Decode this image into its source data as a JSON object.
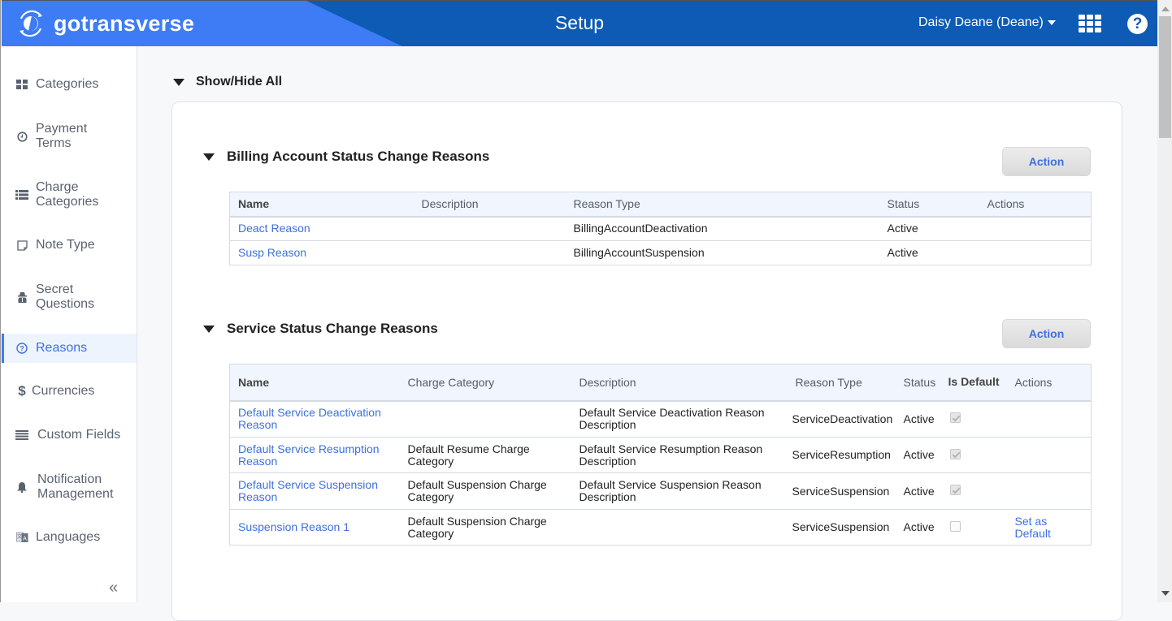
{
  "header": {
    "brand": "gotransverse",
    "title": "Setup",
    "user": "Daisy Deane (Deane)",
    "colors": {
      "banner": "#0d5bb5",
      "brand_bg": "#3d7cf5"
    }
  },
  "sidebar": {
    "items": [
      {
        "label": "Categories",
        "icon": "grid-icon"
      },
      {
        "label": "Payment Terms",
        "icon": "clock-icon"
      },
      {
        "label": "Charge Categories",
        "icon": "list-icon"
      },
      {
        "label": "Note Type",
        "icon": "note-icon"
      },
      {
        "label": "Secret Questions",
        "icon": "spy-icon"
      },
      {
        "label": "Reasons",
        "icon": "question-circle-icon",
        "active": true
      },
      {
        "label": "Currencies",
        "icon": "dollar-icon"
      },
      {
        "label": "Custom Fields",
        "icon": "lines-icon"
      },
      {
        "label": "Notification Management",
        "icon": "bell-icon"
      },
      {
        "label": "Languages",
        "icon": "language-icon"
      }
    ],
    "collapse_label": "«"
  },
  "main": {
    "show_hide_all": "Show/Hide All",
    "sections": [
      {
        "title": "Billing Account Status Change Reasons",
        "action_label": "Action",
        "columns": [
          "Name",
          "Description",
          "Reason Type",
          "Status",
          "Actions"
        ],
        "rows": [
          {
            "name": "Deact Reason",
            "description": "",
            "reason_type": "BillingAccountDeactivation",
            "status": "Active",
            "actions": ""
          },
          {
            "name": "Susp Reason",
            "description": "",
            "reason_type": "BillingAccountSuspension",
            "status": "Active",
            "actions": ""
          }
        ]
      },
      {
        "title": "Service Status Change Reasons",
        "action_label": "Action",
        "columns": [
          "Name",
          "Charge Category",
          "Description",
          "Reason Type",
          "Status",
          "Is Default",
          "Actions"
        ],
        "rows": [
          {
            "name": "Default Service Deactivation Reason",
            "charge_category": "",
            "description": "Default Service Deactivation Reason Description",
            "reason_type": "ServiceDeactivation",
            "status": "Active",
            "is_default": true,
            "actions": ""
          },
          {
            "name": "Default Service Resumption Reason",
            "charge_category": "Default Resume Charge Category",
            "description": "Default Service Resumption Reason Description",
            "reason_type": "ServiceResumption",
            "status": "Active",
            "is_default": true,
            "actions": ""
          },
          {
            "name": "Default Service Suspension Reason",
            "charge_category": "Default Suspension Charge Category",
            "description": "Default Service Suspension Reason Description",
            "reason_type": "ServiceSuspension",
            "status": "Active",
            "is_default": true,
            "actions": ""
          },
          {
            "name": "Suspension Reason 1",
            "charge_category": "Default Suspension Charge Category",
            "description": "",
            "reason_type": "ServiceSuspension",
            "status": "Active",
            "is_default": false,
            "actions": "Set as Default"
          }
        ]
      }
    ]
  }
}
